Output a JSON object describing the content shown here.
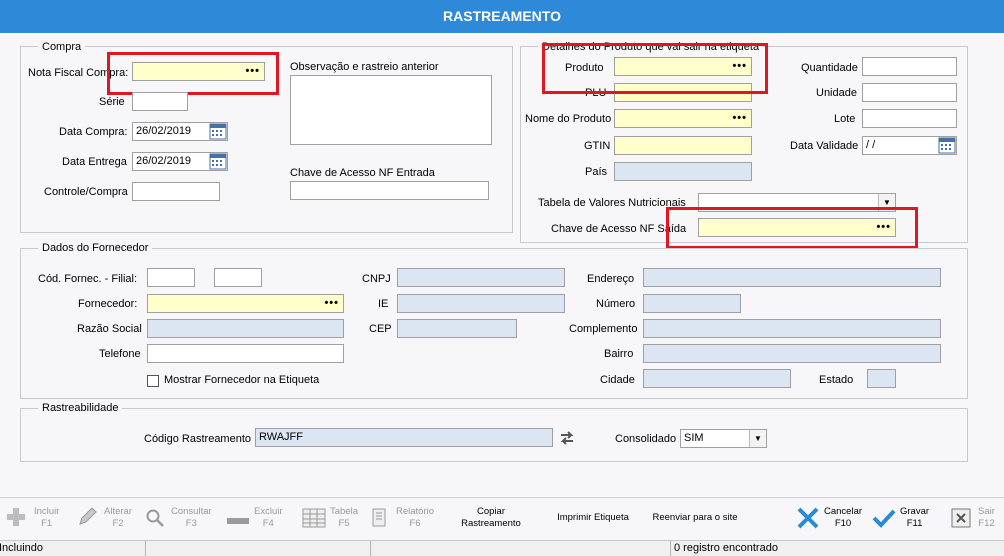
{
  "window": {
    "title": "RASTREAMENTO"
  },
  "compra": {
    "group_label": "Compra",
    "nota_fiscal_label": "Nota Fiscal Compra:",
    "serie_label": "Série",
    "data_compra_label": "Data Compra:",
    "data_compra_value": "26/02/2019",
    "data_entrega_label": "Data Entrega",
    "data_entrega_value": "26/02/2019",
    "controle_label": "Controle/Compra",
    "observacao_label": "Observação e rastreio anterior",
    "chave_entrada_label": "Chave de Acesso NF Entrada"
  },
  "produto": {
    "group_label": "Detalhes do Produto que vai sair na etiqueta",
    "produto_label": "Produto",
    "plu_label": "PLU",
    "nome_label": "Nome do Produto",
    "gtin_label": "GTIN",
    "pais_label": "País",
    "quantidade_label": "Quantidade",
    "unidade_label": "Unidade",
    "lote_label": "Lote",
    "validade_label": "Data Validade",
    "validade_value": " / /",
    "tabela_label": "Tabela de Valores Nutricionais",
    "chave_saida_label": "Chave de Acesso NF Saída"
  },
  "fornecedor": {
    "group_label": "Dados do Fornecedor",
    "cod_label": "Cód. Fornec. - Filial:",
    "fornecedor_label": "Fornecedor:",
    "razao_label": "Razão Social",
    "telefone_label": "Telefone",
    "mostrar_label": "Mostrar Fornecedor na Etiqueta",
    "cnpj_label": "CNPJ",
    "ie_label": "IE",
    "cep_label": "CEP",
    "endereco_label": "Endereço",
    "numero_label": "Número",
    "complemento_label": "Complemento",
    "bairro_label": "Bairro",
    "cidade_label": "Cidade",
    "estado_label": "Estado"
  },
  "rastreabilidade": {
    "group_label": "Rastreabilidade",
    "codigo_label": "Código Rastreamento",
    "codigo_value": "RWAJFF",
    "consolidado_label": "Consolidado",
    "consolidado_value": "SIM"
  },
  "toolbar": {
    "incluir": "Incluir",
    "incluir_key": "F1",
    "alterar": "Alterar",
    "alterar_key": "F2",
    "consultar": "Consultar",
    "consultar_key": "F3",
    "excluir": "Excluir",
    "excluir_key": "F4",
    "tabela": "Tabela",
    "tabela_key": "F5",
    "relatorio": "Relatório",
    "relatorio_key": "F6",
    "copiar_1": "Copiar",
    "copiar_2": "Rastreamento",
    "imprimir": "Imprimir Etiqueta",
    "reenviar": "Reenviar para o site",
    "cancelar": "Cancelar",
    "cancelar_key": "F10",
    "gravar": "Gravar",
    "gravar_key": "F11",
    "sair": "Sair",
    "sair_key": "F12"
  },
  "status": {
    "mode": "Incluindo",
    "records": "0 registro encontrado"
  },
  "colors": {
    "title_bar": "#2e8ad8",
    "highlight": "#e1161f",
    "required": "#ffffcc",
    "readonly": "#dce6f2"
  }
}
